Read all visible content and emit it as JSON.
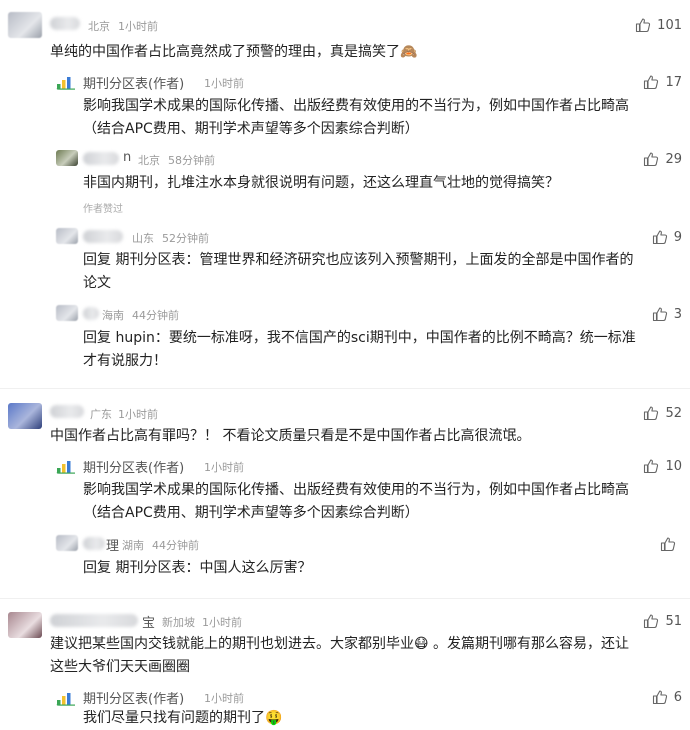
{
  "comments": [
    {
      "location": "北京",
      "time": "1小时前",
      "text": "单纯的中国作者占比高竟然成了预警的理由，真是搞笑了🙈",
      "likes": "101",
      "replies": [
        {
          "author": "期刊分区表(作者)",
          "time": "1小时前",
          "likes": "17",
          "line1": "影响我国学术成果的国际化传播、出版经费有效使用的不当行为，例如中国作者占比畸高",
          "line2": "（结合APC费用、期刊学术声望等多个因素综合判断）"
        },
        {
          "author_fragment": "n",
          "location": "北京",
          "time": "58分钟前",
          "likes": "29",
          "line1": "非国内期刊，扎堆注水本身就很说明有问题，还这么理直气壮地的觉得搞笑？",
          "tag": "作者赞过"
        },
        {
          "location": "山东",
          "time": "52分钟前",
          "likes": "9",
          "line1": "回复 期刊分区表：管理世界和经济研究也应该列入预警期刊，上面发的全部是中国作者的",
          "line2": "论文"
        },
        {
          "location": "海南",
          "time": "44分钟前",
          "likes": "3",
          "line1": "回复 hupin：要统一标准呀，我不信国产的sci期刊中，中国作者的比例不畸高？统一标准",
          "line2": "才有说服力！"
        }
      ]
    },
    {
      "location": "广东",
      "time": "1小时前",
      "text": "中国作者占比高有罪吗？！ 不看论文质量只看是不是中国作者占比高很流氓。",
      "likes": "52",
      "replies": [
        {
          "author": "期刊分区表(作者)",
          "time": "1小时前",
          "likes": "10",
          "line1": "影响我国学术成果的国际化传播、出版经费有效使用的不当行为，例如中国作者占比畸高",
          "line2": "（结合APC费用、期刊学术声望等多个因素综合判断）"
        },
        {
          "author_fragment": "理",
          "location": "湖南",
          "time": "44分钟前",
          "likes": "",
          "line1": "回复 期刊分区表：中国人这么厉害？"
        }
      ]
    },
    {
      "author_fragment": "宝",
      "location": "新加坡",
      "time": "1小时前",
      "line1": "建议把某些国内交钱就能上的期刊也划进去。大家都别毕业😷 。发篇期刊哪有那么容易，还让",
      "line2": "这些大爷们天天画圈圈",
      "likes": "51",
      "replies": [
        {
          "author": "期刊分区表(作者)",
          "time": "1小时前",
          "likes": "6",
          "line1": "我们尽量只找有问题的期刊了🤑"
        }
      ]
    }
  ],
  "icons": {
    "like": "thumbs-up-icon",
    "journal_logo": "bar-chart-logo-icon"
  },
  "colors": {
    "logo_green": "#3aa655",
    "logo_yellow": "#f2c12e",
    "logo_blue": "#3a7bd5"
  }
}
